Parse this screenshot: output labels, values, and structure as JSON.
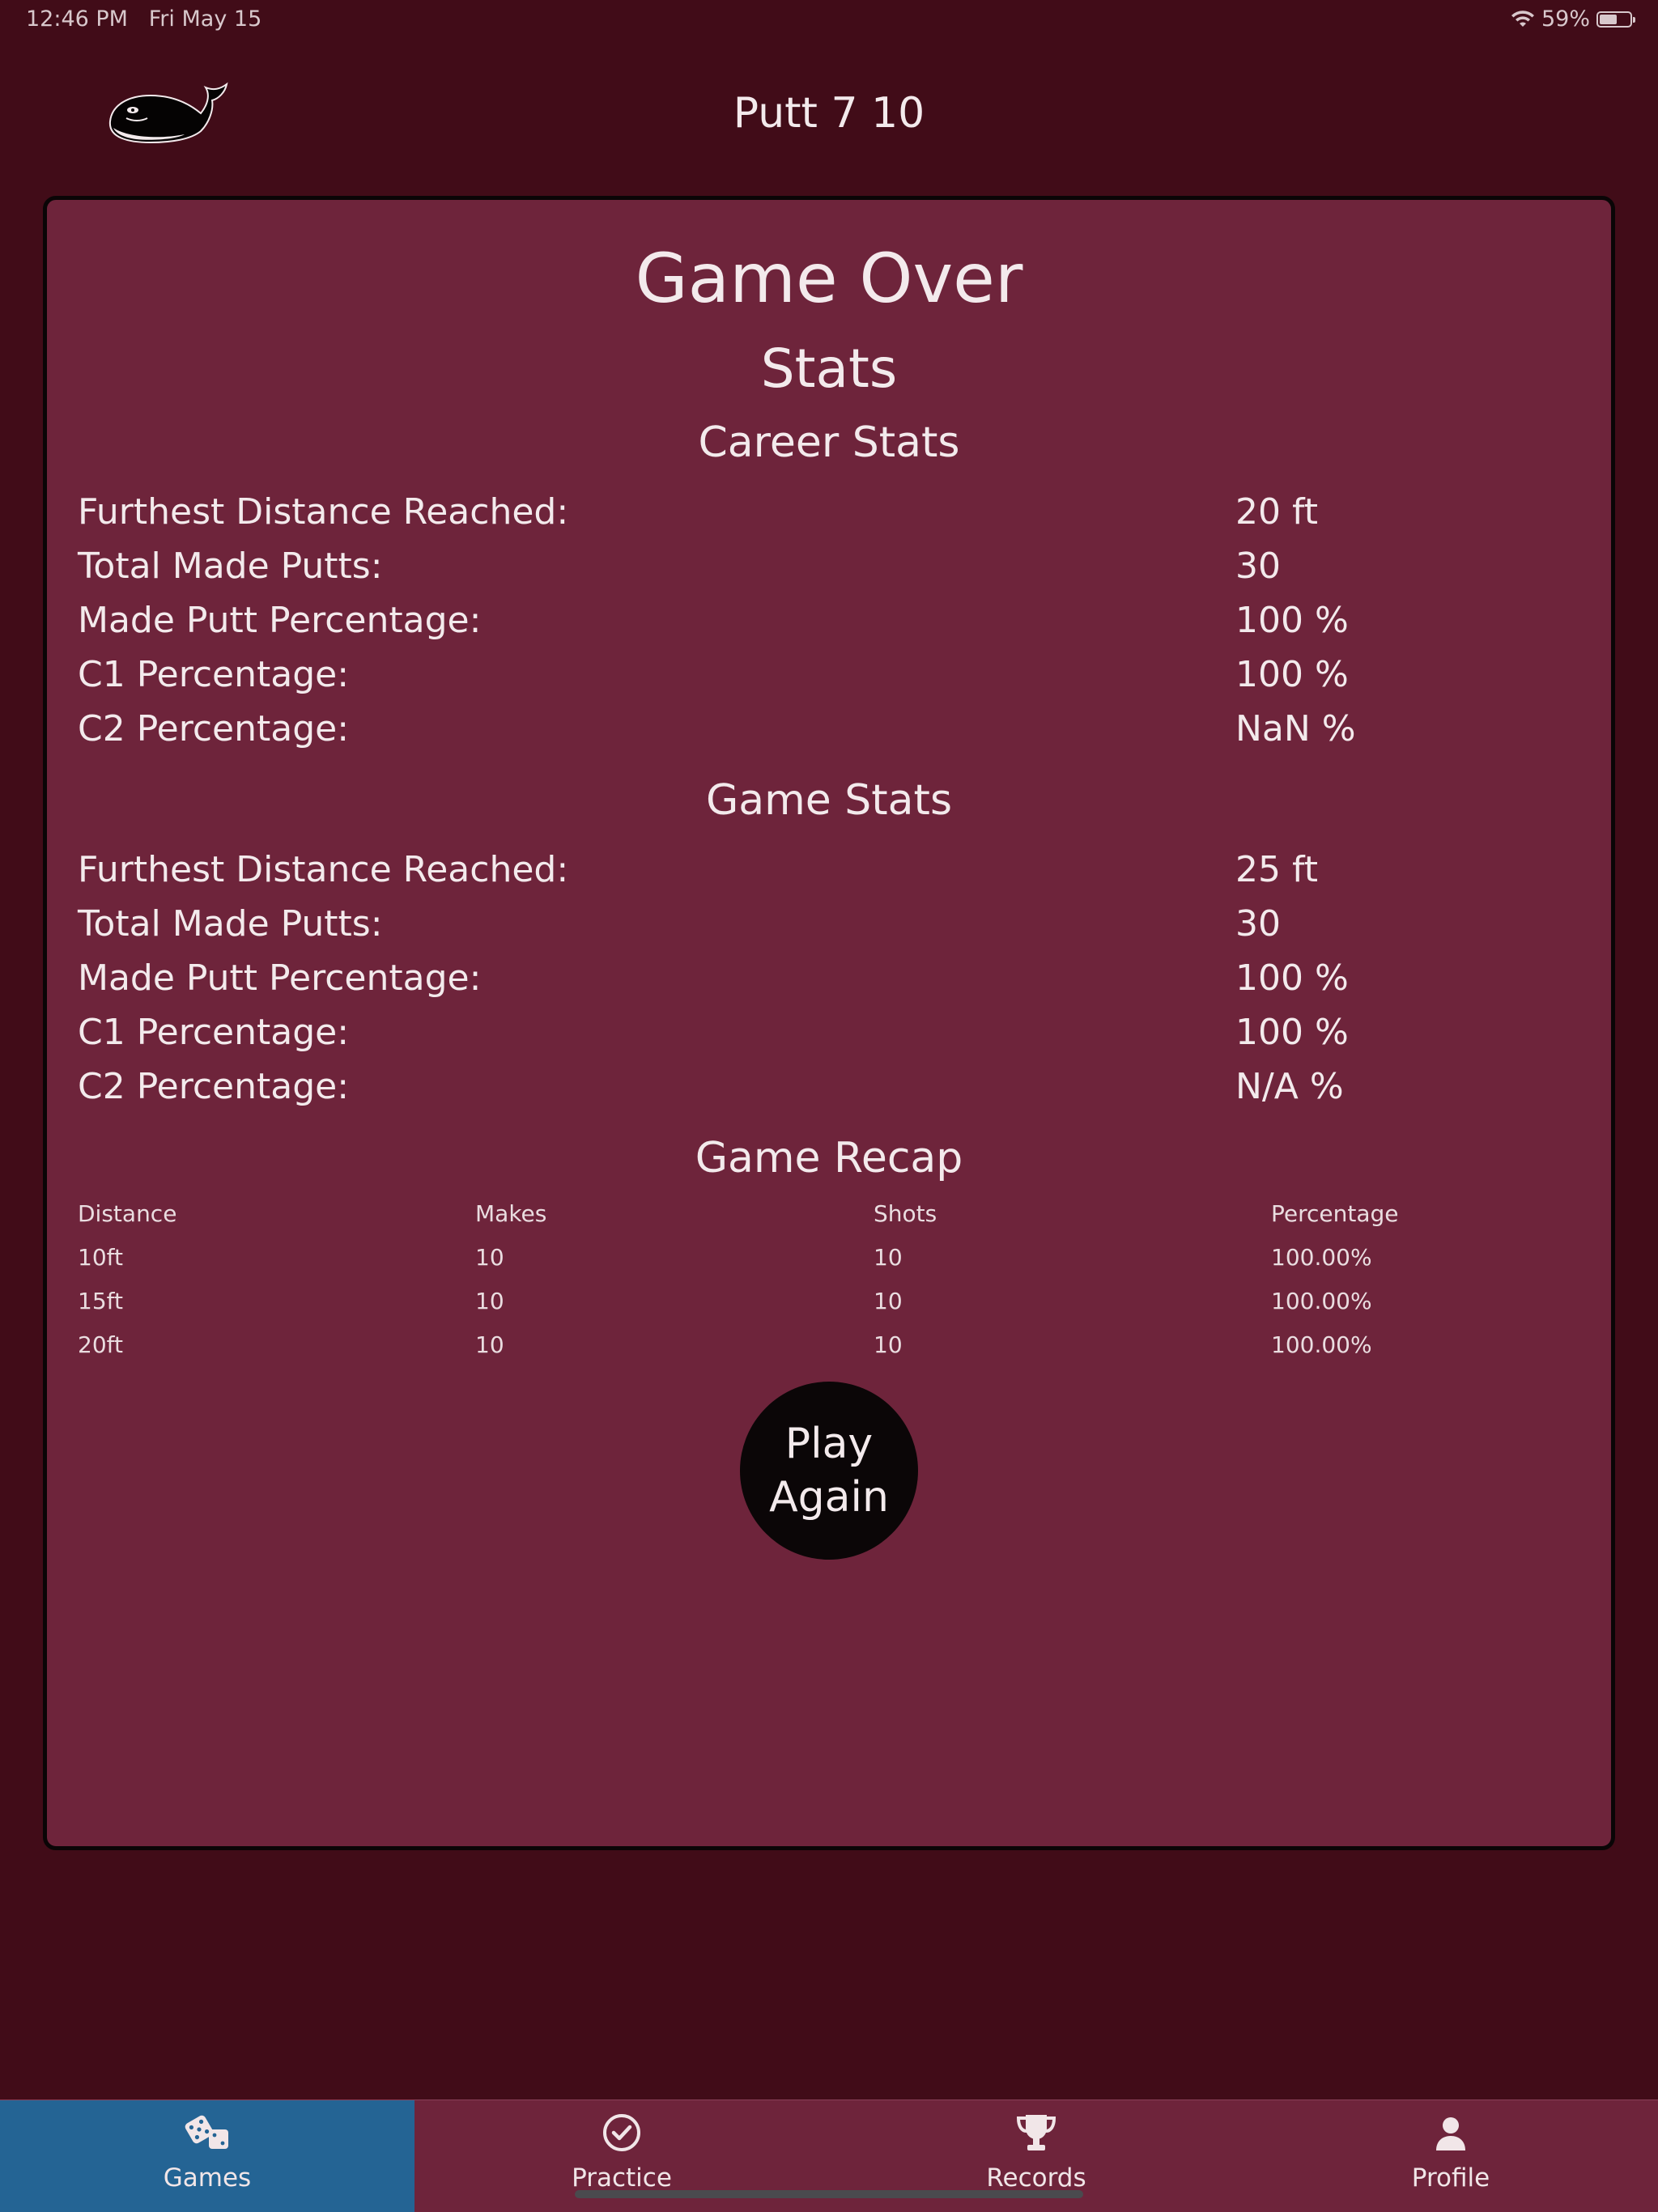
{
  "status_bar": {
    "time": "12:46 PM",
    "date": "Fri May 15",
    "battery": "59%"
  },
  "header": {
    "title": "Putt 7 10"
  },
  "card": {
    "title": "Game Over",
    "subtitle": "Stats",
    "career": {
      "heading": "Career Stats",
      "rows": [
        {
          "label": "Furthest Distance Reached:",
          "value": "20 ft"
        },
        {
          "label": "Total Made Putts:",
          "value": "30"
        },
        {
          "label": "Made Putt Percentage:",
          "value": "100 %"
        },
        {
          "label": "C1 Percentage:",
          "value": "100 %"
        },
        {
          "label": "C2 Percentage:",
          "value": "NaN %"
        }
      ]
    },
    "game": {
      "heading": "Game Stats",
      "rows": [
        {
          "label": "Furthest Distance Reached:",
          "value": "25 ft"
        },
        {
          "label": "Total Made Putts:",
          "value": "30"
        },
        {
          "label": "Made Putt Percentage:",
          "value": "100 %"
        },
        {
          "label": "C1 Percentage:",
          "value": "100 %"
        },
        {
          "label": "C2 Percentage:",
          "value": "N/A %"
        }
      ]
    },
    "recap": {
      "heading": "Game Recap",
      "columns": [
        "Distance",
        "Makes",
        "Shots",
        "Percentage"
      ],
      "rows": [
        [
          "10ft",
          "10",
          "10",
          "100.00%"
        ],
        [
          "15ft",
          "10",
          "10",
          "100.00%"
        ],
        [
          "20ft",
          "10",
          "10",
          "100.00%"
        ]
      ]
    },
    "play_again": {
      "line1": "Play",
      "line2": "Again"
    }
  },
  "tabs": [
    {
      "label": "Games",
      "icon": "dice-icon",
      "active": true
    },
    {
      "label": "Practice",
      "icon": "checkmark-circle-icon",
      "active": false
    },
    {
      "label": "Records",
      "icon": "trophy-icon",
      "active": false
    },
    {
      "label": "Profile",
      "icon": "person-icon",
      "active": false
    }
  ],
  "colors": {
    "background": "#410c18",
    "card": "#6e243b",
    "active_tab": "#246494",
    "button": "#0b0607"
  }
}
